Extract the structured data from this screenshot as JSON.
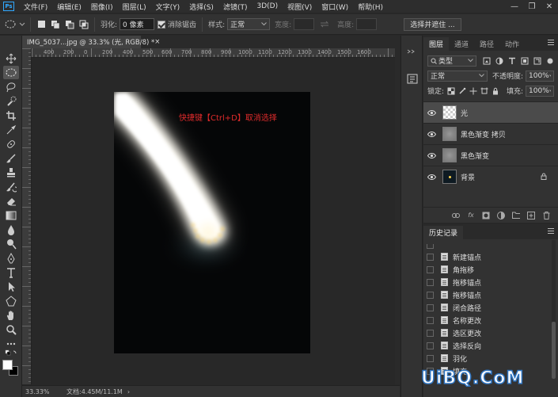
{
  "app": {
    "logo": "Ps",
    "menu": [
      "文件(F)",
      "编辑(E)",
      "图像(I)",
      "图层(L)",
      "文字(Y)",
      "选择(S)",
      "滤镜(T)",
      "3D(D)",
      "视图(V)",
      "窗口(W)",
      "帮助(H)"
    ],
    "window_controls": [
      "—",
      "❐",
      "✕"
    ]
  },
  "options": {
    "feather_label": "羽化:",
    "feather_value": "0 像素",
    "antialias_label": "消除锯齿",
    "style_label": "样式:",
    "style_value": "正常",
    "width_label": "宽度:",
    "height_label": "高度:",
    "select_mask_button": "选择并遮住 ..."
  },
  "document": {
    "tab_title": "IMG_5037...jpg @ 33.3% (光, RGB/8) *",
    "close": "×",
    "ruler_labels": [
      "400",
      "200",
      "0",
      "200",
      "400",
      "500",
      "600",
      "700",
      "800",
      "900",
      "1000",
      "1100",
      "1200",
      "1300",
      "1400",
      "1500",
      "1600"
    ],
    "annotation": "快捷键【Ctrl+D】取消选择"
  },
  "status": {
    "zoom": "33.33%",
    "doc_info": "文档:4.45M/11.1M",
    "arrow": "›"
  },
  "layers_panel": {
    "tabs": [
      "图层",
      "通道",
      "路径",
      "动作"
    ],
    "filter_kind": "类型",
    "blend_mode": "正常",
    "opacity_label": "不透明度:",
    "opacity_value": "100%",
    "lock_label": "锁定:",
    "fill_label": "填充:",
    "fill_value": "100%",
    "layers": [
      {
        "name": "光",
        "selected": true
      },
      {
        "name": "黑色渐变 拷贝",
        "selected": false
      },
      {
        "name": "黑色渐变",
        "selected": false
      },
      {
        "name": "背景",
        "selected": false
      }
    ]
  },
  "history_panel": {
    "title": "历史记录",
    "items": [
      "新建锚点",
      "角拖移",
      "拖移锚点",
      "拖移锚点",
      "闭合路径",
      "名称更改",
      "选区更改",
      "选择反向",
      "羽化",
      "填充"
    ]
  },
  "watermark": "UiBQ.CoM"
}
